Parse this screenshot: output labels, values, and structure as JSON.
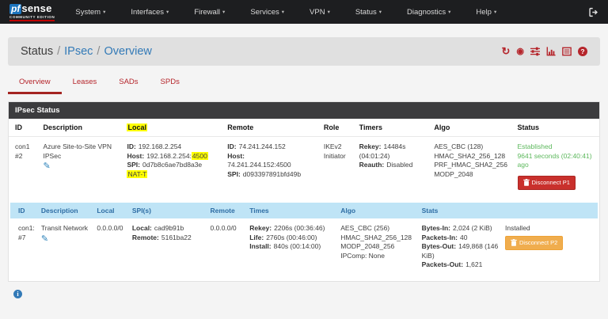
{
  "navbar": {
    "logo": {
      "pf": "pf",
      "sense": "sense",
      "edition": "COMMUNITY EDITION"
    },
    "items": [
      {
        "label": "System"
      },
      {
        "label": "Interfaces"
      },
      {
        "label": "Firewall"
      },
      {
        "label": "Services"
      },
      {
        "label": "VPN"
      },
      {
        "label": "Status"
      },
      {
        "label": "Diagnostics"
      },
      {
        "label": "Help"
      }
    ]
  },
  "breadcrumb": {
    "section": "Status",
    "separator": "/",
    "subsection": "IPsec",
    "page": "Overview"
  },
  "header_action_icons": [
    "refresh-icon",
    "record-icon",
    "sliders-icon",
    "chart-icon",
    "log-icon",
    "help-icon"
  ],
  "tabs": [
    {
      "label": "Overview",
      "active": true
    },
    {
      "label": "Leases",
      "active": false
    },
    {
      "label": "SADs",
      "active": false
    },
    {
      "label": "SPDs",
      "active": false
    }
  ],
  "panel": {
    "title": "IPsec Status"
  },
  "colors": {
    "accent_red": "#b5252b",
    "link_blue": "#337ab7",
    "success_green": "#5cb85c",
    "danger_red": "#c9302c",
    "warning_orange": "#f0ad4e",
    "highlight_yellow": "#ffff00",
    "child_header_bg": "#bfe4f6"
  },
  "p1_table": {
    "headers": [
      "ID",
      "Description",
      "Local",
      "Remote",
      "Role",
      "Timers",
      "Algo",
      "Status"
    ],
    "row": {
      "id_line1": "con1",
      "id_line2": "#2",
      "desc_line1": "Azure Site-to-Site VPN",
      "desc_line2": "IPSec",
      "local_id_label": "ID:",
      "local_id": "192.168.2.254",
      "local_host_label": "Host:",
      "local_host": "192.168.2.254:",
      "local_host_port": "4500",
      "local_spi_label": "SPI:",
      "local_spi": "0d7b8c6ae7bd8a3e",
      "local_nat": "NAT-T",
      "remote_id_label": "ID:",
      "remote_id": "74.241.244.152",
      "remote_host_label": "Host:",
      "remote_host": "74.241.244.152:4500",
      "remote_spi_label": "SPI:",
      "remote_spi": "d093397891bfd49b",
      "role_line1": "IKEv2",
      "role_line2": "Initiator",
      "rekey_label": "Rekey:",
      "rekey_value": "14484s",
      "rekey_value2": "(04:01:24)",
      "reauth_label": "Reauth:",
      "reauth_value": "Disabled",
      "algo_lines": [
        "AES_CBC (128)",
        "HMAC_SHA2_256_128",
        "PRF_HMAC_SHA2_256",
        "MODP_2048"
      ],
      "status_line1": "Established",
      "status_line2": "9641 seconds (02:40:41)",
      "status_line3": "ago",
      "disconnect_label": "Disconnect P1"
    }
  },
  "p2_table": {
    "headers": [
      "ID",
      "Description",
      "Local",
      "SPI(s)",
      "Remote",
      "Times",
      "Algo",
      "Stats"
    ],
    "row": {
      "id_line1": "con1:",
      "id_line2": "#7",
      "desc": "Transit Network",
      "local": "0.0.0.0/0",
      "spi_local_label": "Local:",
      "spi_local": "cad9b91b",
      "spi_remote_label": "Remote:",
      "spi_remote": "5161ba22",
      "remote": "0.0.0.0/0",
      "rekey_label": "Rekey:",
      "rekey": "2206s (00:36:46)",
      "life_label": "Life:",
      "life": "2760s (00:46:00)",
      "install_label": "Install:",
      "install": "840s (00:14:00)",
      "algo_lines": [
        "AES_CBC (256)",
        "HMAC_SHA2_256_128",
        "MODP_2048_256",
        "IPComp: None"
      ],
      "bytes_in_label": "Bytes-In:",
      "bytes_in": "2,024 (2 KiB)",
      "packets_in_label": "Packets-In:",
      "packets_in": "40",
      "bytes_out_label": "Bytes-Out:",
      "bytes_out": "149,868 (146 KiB)",
      "packets_out_label": "Packets-Out:",
      "packets_out": "1,621",
      "state": "Installed",
      "disconnect_label": "Disconnect P2"
    }
  }
}
